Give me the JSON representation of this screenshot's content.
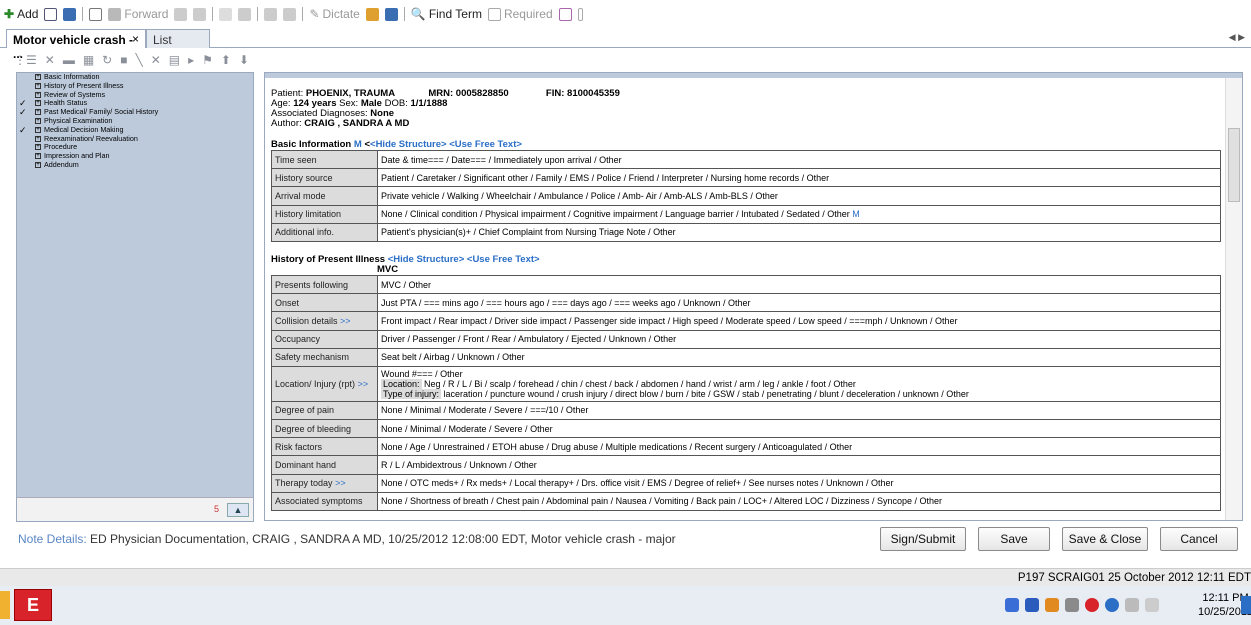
{
  "toolbar": {
    "add": "Add",
    "forward": "Forward",
    "dictate": "Dictate",
    "find_term": "Find Term",
    "required": "Required"
  },
  "tabs": {
    "active": "Motor vehicle crash - ...",
    "close": "×",
    "list": "List"
  },
  "tree": [
    {
      "label": "Basic Information",
      "checked": false
    },
    {
      "label": "History of Present Illness",
      "checked": false
    },
    {
      "label": "Review of Systems",
      "checked": false
    },
    {
      "label": "Health Status",
      "checked": true
    },
    {
      "label": "Past Medical/ Family/ Social History",
      "checked": true
    },
    {
      "label": "Physical Examination",
      "checked": false
    },
    {
      "label": "Medical Decision Making",
      "checked": true
    },
    {
      "label": "Reexamination/ Reevaluation",
      "checked": false
    },
    {
      "label": "Procedure",
      "checked": false
    },
    {
      "label": "Impression and Plan",
      "checked": false
    },
    {
      "label": "Addendum",
      "checked": false
    }
  ],
  "tree_footer_num": "5",
  "patient": {
    "patient_label": "Patient:",
    "name": "PHOENIX, TRAUMA",
    "mrn_label": "MRN:",
    "mrn": "0005828850",
    "fin_label": "FIN:",
    "fin": "8100045359",
    "age_label": "Age:",
    "age": "124 years",
    "sex_label": "Sex:",
    "sex": "Male",
    "dob_label": "DOB:",
    "dob": "1/1/1888",
    "diag_label": "Associated Diagnoses:",
    "diag": "None",
    "author_label": "Author:",
    "author": "CRAIG , SANDRA A MD"
  },
  "basic": {
    "title": "Basic Information",
    "m": "M",
    "hide": "<Hide Structure>",
    "free": "<Use Free Text>",
    "rows": [
      {
        "label": "Time seen",
        "value": "Date & time=== / Date=== / Immediately upon arrival / Other"
      },
      {
        "label": "History source",
        "value": "Patient / Caretaker / Significant other / Family / EMS / Police / Friend / Interpreter / Nursing home records / Other"
      },
      {
        "label": "Arrival mode",
        "value": "Private vehicle / Walking / Wheelchair / Ambulance / Police / Amb- Air / Amb-ALS / Amb-BLS / Other"
      },
      {
        "label": "History limitation",
        "value": "None / Clinical condition / Physical impairment / Cognitive impairment / Language barrier / Intubated / Sedated / Other",
        "m": "M"
      },
      {
        "label": "Additional info.",
        "value": "Patient's physician(s)+ / Chief Complaint from Nursing Triage Note / Other"
      }
    ]
  },
  "hpi": {
    "title": "History of Present Illness",
    "hide": "<Hide Structure>",
    "free": "<Use Free Text>",
    "sub": "MVC",
    "rows": [
      {
        "label": "Presents following",
        "value": "MVC / Other"
      },
      {
        "label": "Onset",
        "value": "Just PTA / === mins ago / === hours ago / === days ago / === weeks ago / Unknown / Other"
      },
      {
        "label": "Collision details",
        "more": ">>",
        "value": "Front impact / Rear impact / Driver side impact / Passenger side impact / High speed / Moderate speed / Low speed / ===mph / Unknown / Other"
      },
      {
        "label": "Occupancy",
        "value": "Driver / Passenger / Front / Rear / Ambulatory / Ejected / Unknown / Other"
      },
      {
        "label": "Safety mechanism",
        "value": "Seat belt / Airbag / Unknown / Other"
      }
    ],
    "location": {
      "label": "Location/ Injury (rpt)",
      "more": ">>",
      "line1": "Wound #=== / Other",
      "loc_label": "Location:",
      "loc_value": "Neg / R / L / Bi / scalp / forehead / chin / chest / back / abdomen / hand / wrist / arm / leg / ankle / foot / Other",
      "type_label": "Type of injury:",
      "type_value": "laceration / puncture wound / crush injury / direct blow / burn / bite / GSW / stab / penetrating / blunt / deceleration / unknown / Other"
    },
    "rows2": [
      {
        "label": "Degree of pain",
        "value": "None / Minimal / Moderate / Severe / ===/10 / Other"
      },
      {
        "label": "Degree of bleeding",
        "value": "None / Minimal / Moderate / Severe / Other"
      },
      {
        "label": "Risk factors",
        "value": "None / Age / Unrestrained / ETOH abuse / Drug abuse / Multiple medications / Recent surgery / Anticoagulated / Other"
      },
      {
        "label": "Dominant hand",
        "value": "R / L / Ambidextrous / Unknown / Other"
      },
      {
        "label": "Therapy today",
        "more": ">>",
        "value": "None / OTC meds+ / Rx meds+ / Local therapy+ / Drs. office visit / EMS / Degree of relief+ / See nurses notes / Unknown / Other"
      },
      {
        "label": "Associated symptoms",
        "value": "None / Shortness of breath / Chest pain / Abdominal pain / Nausea / Vomiting / Back pain / LOC+ / Altered LOC / Dizziness / Syncope / Other"
      }
    ]
  },
  "note": {
    "label": "Note Details:",
    "value": "ED Physician Documentation, CRAIG , SANDRA A MD, 10/25/2012 12:08:00 EDT, Motor vehicle crash - major"
  },
  "buttons": {
    "sign": "Sign/Submit",
    "save": "Save",
    "save_close": "Save & Close",
    "cancel": "Cancel"
  },
  "status": "P197  SCRAIG01  25 October 2012  12:11 EDT",
  "clock": {
    "time": "12:11 PM",
    "date": "10/25/2012"
  },
  "colors": {
    "accent": "#2a6ec6",
    "tree_bg": "#bccadb",
    "label_bg": "#dcdcdc"
  }
}
